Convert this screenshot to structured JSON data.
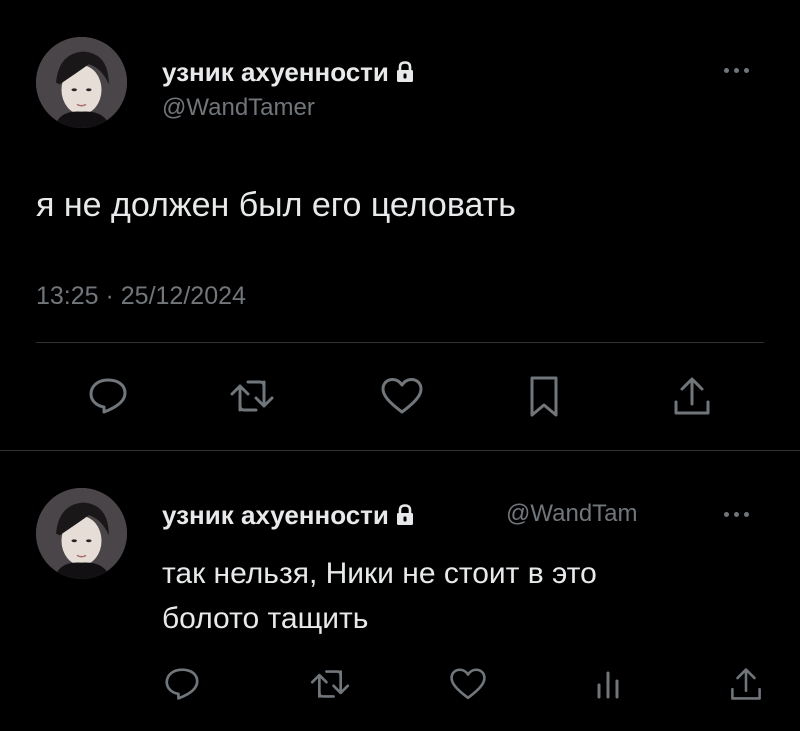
{
  "main_tweet": {
    "author_name": "узник ахуенности",
    "author_handle": "@WandTamer",
    "lock_icon": "lock-icon",
    "more_icon": "more-dots-icon",
    "text": "я не должен был его целовать",
    "timestamp": "13:25 · 25/12/2024",
    "actions": [
      "reply-icon",
      "retweet-icon",
      "like-icon",
      "bookmark-icon",
      "share-icon"
    ]
  },
  "reply_tweet": {
    "author_name": "узник ахуенности",
    "author_handle": "@WandTam",
    "lock_icon": "lock-icon",
    "more_icon": "more-dots-icon",
    "text_line1": "так нельзя, Ники не стоит в это",
    "text_line2": "болото тащить",
    "actions": [
      "reply-icon",
      "retweet-icon",
      "like-icon",
      "views-icon",
      "share-icon"
    ]
  },
  "colors": {
    "background": "#000000",
    "primary_text": "#e7e9ea",
    "secondary_text": "#71767b",
    "divider": "#2f3336"
  }
}
